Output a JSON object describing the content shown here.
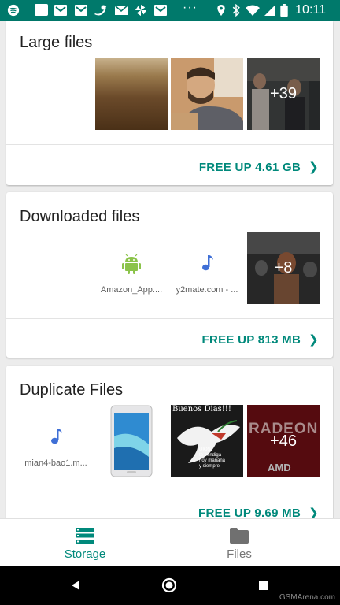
{
  "status_bar": {
    "time": "10:11",
    "icons": [
      "spotify-icon",
      "square-icon",
      "gmail-icon",
      "gmail-icon",
      "twitter-icon",
      "mail-icon",
      "pinwheel-icon",
      "gmail-icon",
      "more-icon",
      "location-icon",
      "bluetooth-icon",
      "wifi-icon",
      "signal-icon",
      "battery-icon"
    ]
  },
  "cards": {
    "large": {
      "title": "Large files",
      "more_count": "+39",
      "action": "FREE UP 4.61 GB"
    },
    "downloaded": {
      "title": "Downloaded files",
      "file1": "Amazon_App....",
      "file2": "y2mate.com - ...",
      "more_count": "+8",
      "action": "FREE UP 813 MB"
    },
    "duplicate": {
      "title": "Duplicate Files",
      "file1": "mian4-bao1.m...",
      "more_count": "+46",
      "thumb_text_1": "Buenos Dias!!!",
      "thumb_text_2": "DIOS\nte bendiga\nhoy mañana\ny siempre",
      "thumb_text_3": "RADEON",
      "thumb_text_4": "AMD",
      "action": "FREE UP 9.69 MB"
    }
  },
  "bottom_nav": {
    "storage_label": "Storage",
    "files_label": "Files"
  },
  "watermark": "GSMArena.com",
  "colors": {
    "accent": "#00897b",
    "status_bar": "#00796b",
    "android_green": "#8bc34a",
    "music_blue": "#3f6fd6"
  }
}
